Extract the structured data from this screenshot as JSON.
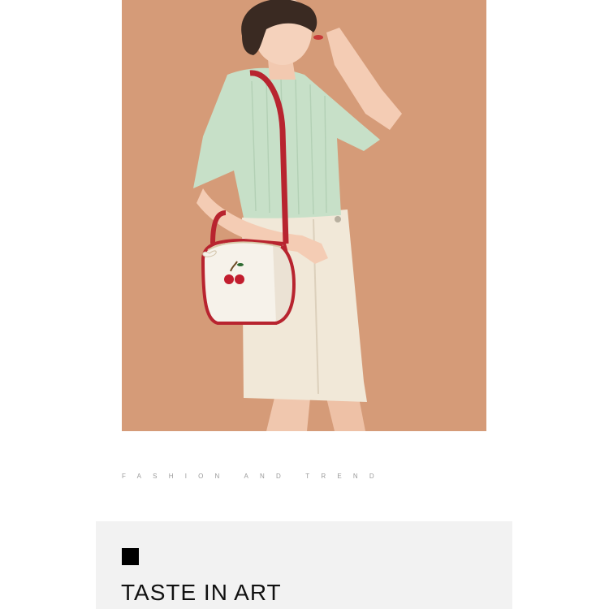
{
  "colors": {
    "backdrop": "#d9a07d",
    "shirt": "#c7e0c8",
    "skirt": "#f1e8d8",
    "bag_trim": "#b8242f",
    "cherry": "#c21d2e",
    "panel": "#f2f2f2"
  },
  "photo": {
    "subject": "woman wearing a mint t-shirt and cream skirt carrying a white bag with red trim and cherry charm"
  },
  "tagline": "FASHION AND TREND",
  "section": {
    "marker_icon": "black-square-icon",
    "heading": "TASTE IN ART"
  }
}
